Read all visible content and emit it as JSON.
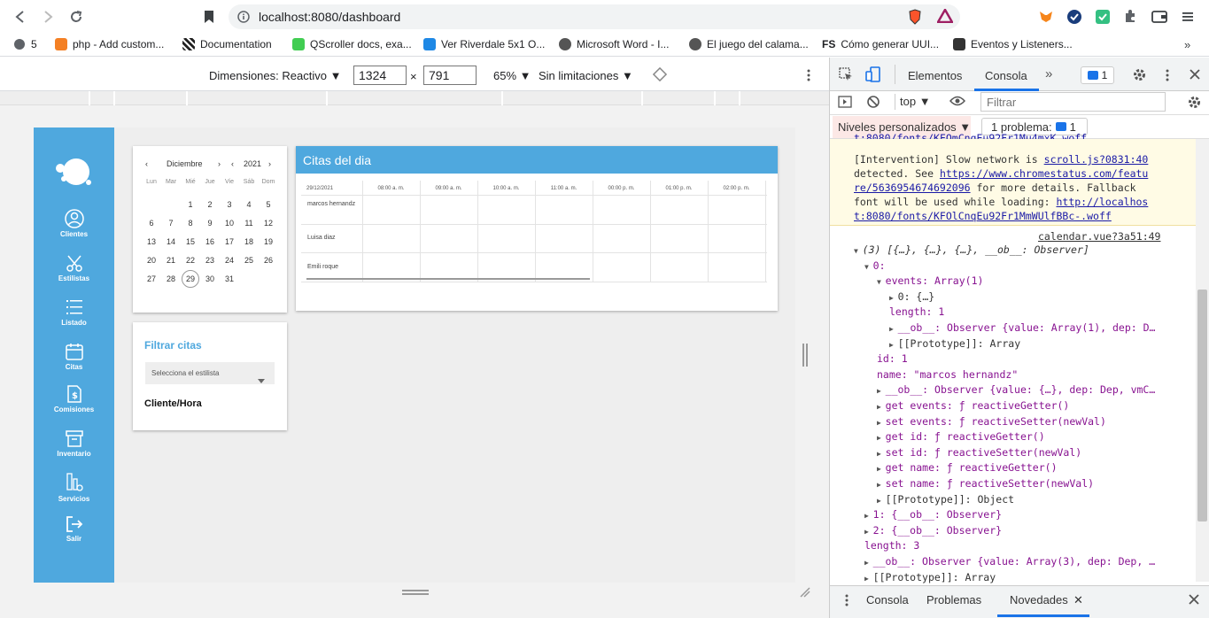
{
  "browser": {
    "url": "localhost:8080/dashboard",
    "bookmarks": [
      {
        "label": "5",
        "color": "#444444"
      },
      {
        "label": "php - Add custom...",
        "color": "#f48024"
      },
      {
        "label": "Documentation",
        "color": "#222222"
      },
      {
        "label": "QScroller docs, exa...",
        "color": "#41cd52"
      },
      {
        "label": "Ver Riverdale 5x1 O...",
        "color": "#1e88e5"
      },
      {
        "label": "Microsoft Word - I...",
        "color": "#555555"
      },
      {
        "label": "El juego del calama...",
        "color": "#555555"
      },
      {
        "label": "Cómo generar UUI...",
        "color": "#222222"
      },
      {
        "label": "Eventos y Listeners...",
        "color": "#333333"
      }
    ]
  },
  "device_toolbar": {
    "dimensions": "Dimensiones: Reactivo",
    "width": "1324",
    "height": "791",
    "times": "×",
    "zoom": "65%",
    "throttle": "Sin limitaciones"
  },
  "sidebar": {
    "items": [
      {
        "label": "Clientes"
      },
      {
        "label": "Estilistas"
      },
      {
        "label": "Listado"
      },
      {
        "label": "Citas"
      },
      {
        "label": "Comisiones"
      },
      {
        "label": "Inventario"
      },
      {
        "label": "Servicios"
      },
      {
        "label": "Salir"
      }
    ]
  },
  "calendar": {
    "month": "Diciembre",
    "year": "2021",
    "weekdays": [
      "Lun",
      "Mar",
      "Mié",
      "Jue",
      "Vie",
      "Sáb",
      "Dom"
    ],
    "weeks": [
      [
        "",
        "",
        "1",
        "2",
        "3",
        "4",
        "5"
      ],
      [
        "6",
        "7",
        "8",
        "9",
        "10",
        "11",
        "12"
      ],
      [
        "13",
        "14",
        "15",
        "16",
        "17",
        "18",
        "19"
      ],
      [
        "20",
        "21",
        "22",
        "23",
        "24",
        "25",
        "26"
      ],
      [
        "27",
        "28",
        "29",
        "30",
        "31",
        "",
        ""
      ]
    ],
    "today": "29"
  },
  "schedule": {
    "title": "Citas del dia",
    "date": "29/12/2021",
    "hours": [
      "08:00 a. m.",
      "09:00 a. m.",
      "10:00 a. m.",
      "11:00 a. m.",
      "00:00 p. m.",
      "01:00 p. m.",
      "02:00 p. m."
    ],
    "rows": [
      "marcos hernandz",
      "Luisa diaz",
      "Emili roque"
    ]
  },
  "filter": {
    "title": "Filtrar citas",
    "select_placeholder": "Selecciona el estilista",
    "client_label": "Cliente/Hora"
  },
  "devtools": {
    "tabs": [
      "Elementos",
      "Consola"
    ],
    "badge": "1",
    "context": "top",
    "filter_placeholder": "Filtrar",
    "levels": "Niveles personalizados",
    "problems": "1 problema:",
    "problems_count": "1",
    "cut_line": "t:8080/fonts/KFOmCnqEu92Fr1Mu4mxK.woff",
    "warning": {
      "l1a": "[Intervention] Slow network is ",
      "l1link": "scroll.js?0831:40",
      "l2a": "detected. See ",
      "l2link": "https://www.chromestatus.com/featu",
      "l3link": "re/5636954674692096",
      "l3b": " for more details. Fallback",
      "l4a": "font will be used while loading: ",
      "l4link": "http://localhos",
      "l5link": "t:8080/fonts/KFOlCnqEu92Fr1MmWUlfBBc-.woff"
    },
    "source": "calendar.vue?3a51:49",
    "tree": [
      "(3) [{…}, {…}, {…}, __ob__: Observer]",
      "0:",
      "events: Array(1)",
      "0: {…}",
      "length: 1",
      "__ob__: Observer {value: Array(1), dep: D…",
      "[[Prototype]]: Array",
      "id: 1",
      "name: \"marcos hernandz\"",
      "__ob__: Observer {value: {…}, dep: Dep, vmC…",
      "get events: ƒ reactiveGetter()",
      "set events: ƒ reactiveSetter(newVal)",
      "get id: ƒ reactiveGetter()",
      "set id: ƒ reactiveSetter(newVal)",
      "get name: ƒ reactiveGetter()",
      "set name: ƒ reactiveSetter(newVal)",
      "[[Prototype]]: Object",
      "1: {__ob__: Observer}",
      "2: {__ob__: Observer}",
      "length: 3",
      "__ob__: Observer {value: Array(3), dep: Dep, …",
      "[[Prototype]]: Array"
    ],
    "drawer_tabs": [
      "Consola",
      "Problemas",
      "Novedades"
    ]
  }
}
